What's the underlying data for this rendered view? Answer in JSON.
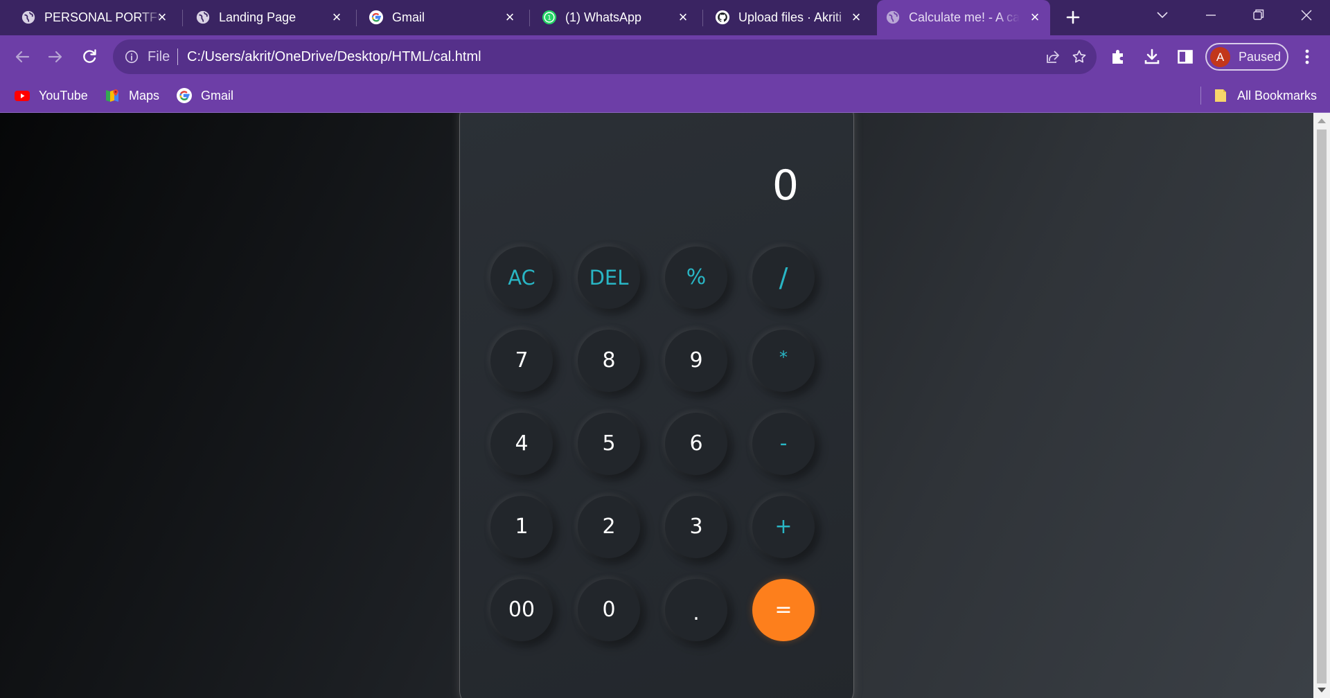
{
  "tabs": [
    {
      "title": "PERSONAL PORTFOLIO",
      "icon": "globe-icon",
      "active": false
    },
    {
      "title": "Landing Page",
      "icon": "globe-icon",
      "active": false
    },
    {
      "title": "Gmail",
      "icon": "google-icon",
      "active": false
    },
    {
      "title": "(1) WhatsApp",
      "icon": "whatsapp-icon",
      "active": false
    },
    {
      "title": "Upload files · Akriti",
      "icon": "github-icon",
      "active": false
    },
    {
      "title": "Calculate me! - A calculator",
      "icon": "globe-icon",
      "active": true
    }
  ],
  "toolbar": {
    "scheme_label": "File",
    "url": "C:/Users/akrit/OneDrive/Desktop/HTML/cal.html",
    "profile_initial": "A",
    "profile_status": "Paused"
  },
  "bookmarks": {
    "items": [
      {
        "label": "YouTube",
        "icon": "youtube-icon"
      },
      {
        "label": "Maps",
        "icon": "maps-icon"
      },
      {
        "label": "Gmail",
        "icon": "google-icon"
      }
    ],
    "all_bookmarks_label": "All Bookmarks"
  },
  "calculator": {
    "display": "0",
    "accent_color": "#29b6c5",
    "equals_color": "#fd7f1c",
    "keys": [
      [
        "AC",
        "DEL",
        "%",
        "/"
      ],
      [
        "7",
        "8",
        "9",
        "*"
      ],
      [
        "4",
        "5",
        "6",
        "-"
      ],
      [
        "1",
        "2",
        "3",
        "+"
      ],
      [
        "00",
        "0",
        ".",
        "="
      ]
    ]
  }
}
